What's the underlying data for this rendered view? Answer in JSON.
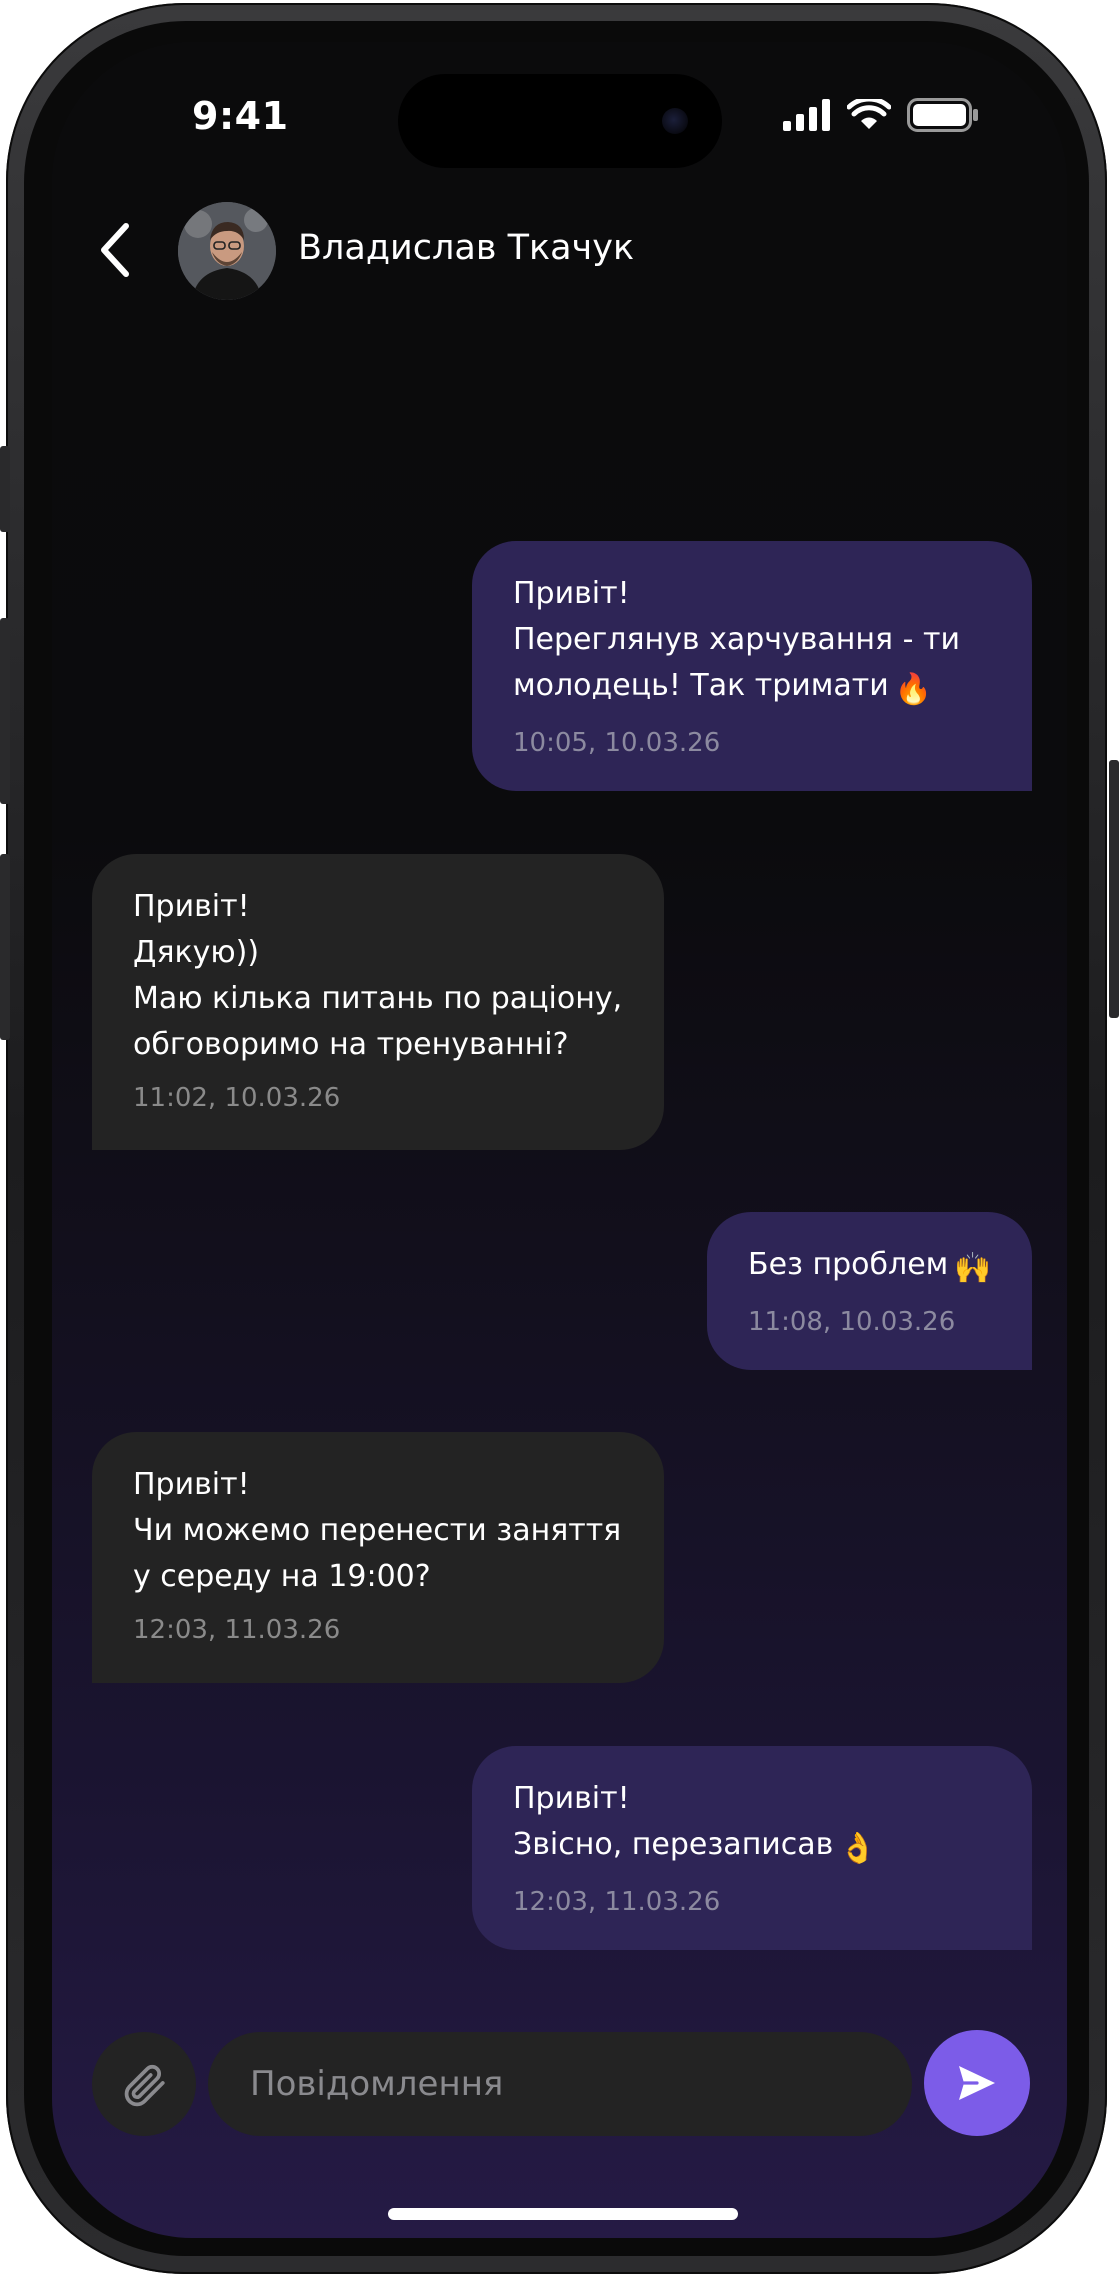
{
  "status_bar": {
    "time": "9:41",
    "signal_icon": "cellular-signal-icon",
    "wifi_icon": "wifi-icon",
    "battery_icon": "battery-icon"
  },
  "header": {
    "back_icon": "chevron-left-icon",
    "contact_name": "Владислав Ткачук"
  },
  "messages": [
    {
      "direction": "outgoing",
      "lines": [
        "Привіт!",
        "Переглянув харчування - ти",
        "молодець! Так тримати"
      ],
      "emoji": "🔥",
      "time": "10:05, 10.03.26"
    },
    {
      "direction": "incoming",
      "lines": [
        "Привіт!",
        "Дякую))",
        "Маю кілька питань по раціону,",
        "обговоримо на тренуванні?"
      ],
      "time": "11:02, 10.03.26"
    },
    {
      "direction": "outgoing",
      "lines": [
        "Без проблем"
      ],
      "emoji": "🙌",
      "time": "11:08, 10.03.26"
    },
    {
      "direction": "incoming",
      "lines": [
        "Привіт!",
        "Чи можемо перенести заняття",
        "у середу на 19:00?"
      ],
      "time": "12:03, 11.03.26"
    },
    {
      "direction": "outgoing",
      "lines": [
        "Привіт!",
        "Звісно, перезаписав"
      ],
      "emoji": "👌",
      "time": "12:03, 11.03.26"
    }
  ],
  "composer": {
    "attach_icon": "paperclip-icon",
    "placeholder": "Повідомлення",
    "value": "",
    "send_icon": "send-icon"
  },
  "colors": {
    "outgoing_bubble": "#2e2556",
    "incoming_bubble": "#232323",
    "accent": "#7c5ce8"
  }
}
